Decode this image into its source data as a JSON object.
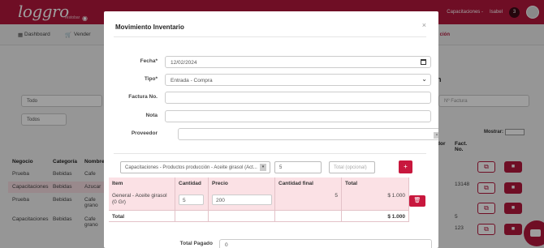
{
  "app": {
    "logo_text": "loggro",
    "logo_sub": "restobar",
    "user_menu": "Capacitaciones -",
    "user_name": "Isabel",
    "user_badge": "3"
  },
  "menu": {
    "dashboard": "Dashboard",
    "vender": "Vender",
    "right_item": "ción"
  },
  "background": {
    "filter_todo": "Todo",
    "filter_todos": "Todos",
    "factura_placeholder": "Nº Factura",
    "section_title": "n",
    "mostrar_label": "Mostrar:",
    "table_headers": [
      "Negocio",
      "Categoría",
      "Nombre"
    ],
    "table_rows": [
      [
        "Prueba",
        "Bebidas",
        "Cafe"
      ],
      [
        "Capacitaciones",
        "Bebidas",
        "Azucar"
      ],
      [
        "Prueba",
        "Bebidas",
        "Cafe grano"
      ],
      [
        "Capacitaciones",
        "Bebidas",
        "Cafe grano"
      ]
    ],
    "right_headers": [
      "dor",
      "Fact. No."
    ],
    "right_values": [
      "13148",
      "5",
      "123"
    ]
  },
  "modal": {
    "title": "Movimiento Inventario",
    "close_label": "×",
    "fecha_label": "Fecha*",
    "fecha_value": "12/02/2024",
    "tipo_label": "Tipo*",
    "tipo_value": "Entrada - Compra",
    "factura_label": "Factura No.",
    "factura_value": "",
    "nota_label": "Nota",
    "nota_value": "",
    "proveedor_label": "Proveedor",
    "proveedor_value": "",
    "proveedor_clear": "×",
    "producto_value": "Capacitaciones - Productos producción - Aceite girasol (Act...",
    "cantidad_value": "5",
    "total_placeholder": "Total (opcional)",
    "add_label": "+",
    "table": {
      "headers": [
        "Item",
        "Cantidad",
        "Precio",
        "Cantidad final",
        "Total"
      ],
      "rows": [
        {
          "item": "General - Aceite girasol (0 Gr)",
          "cantidad": "5",
          "precio": "200",
          "cantidad_final": "5",
          "total": "$ 1.000"
        }
      ],
      "total_label": "Total",
      "total_value": "$ 1.000"
    },
    "delete_label": "🗑",
    "total_pagado_label": "Total Pagado",
    "total_pagado_value": "0"
  }
}
